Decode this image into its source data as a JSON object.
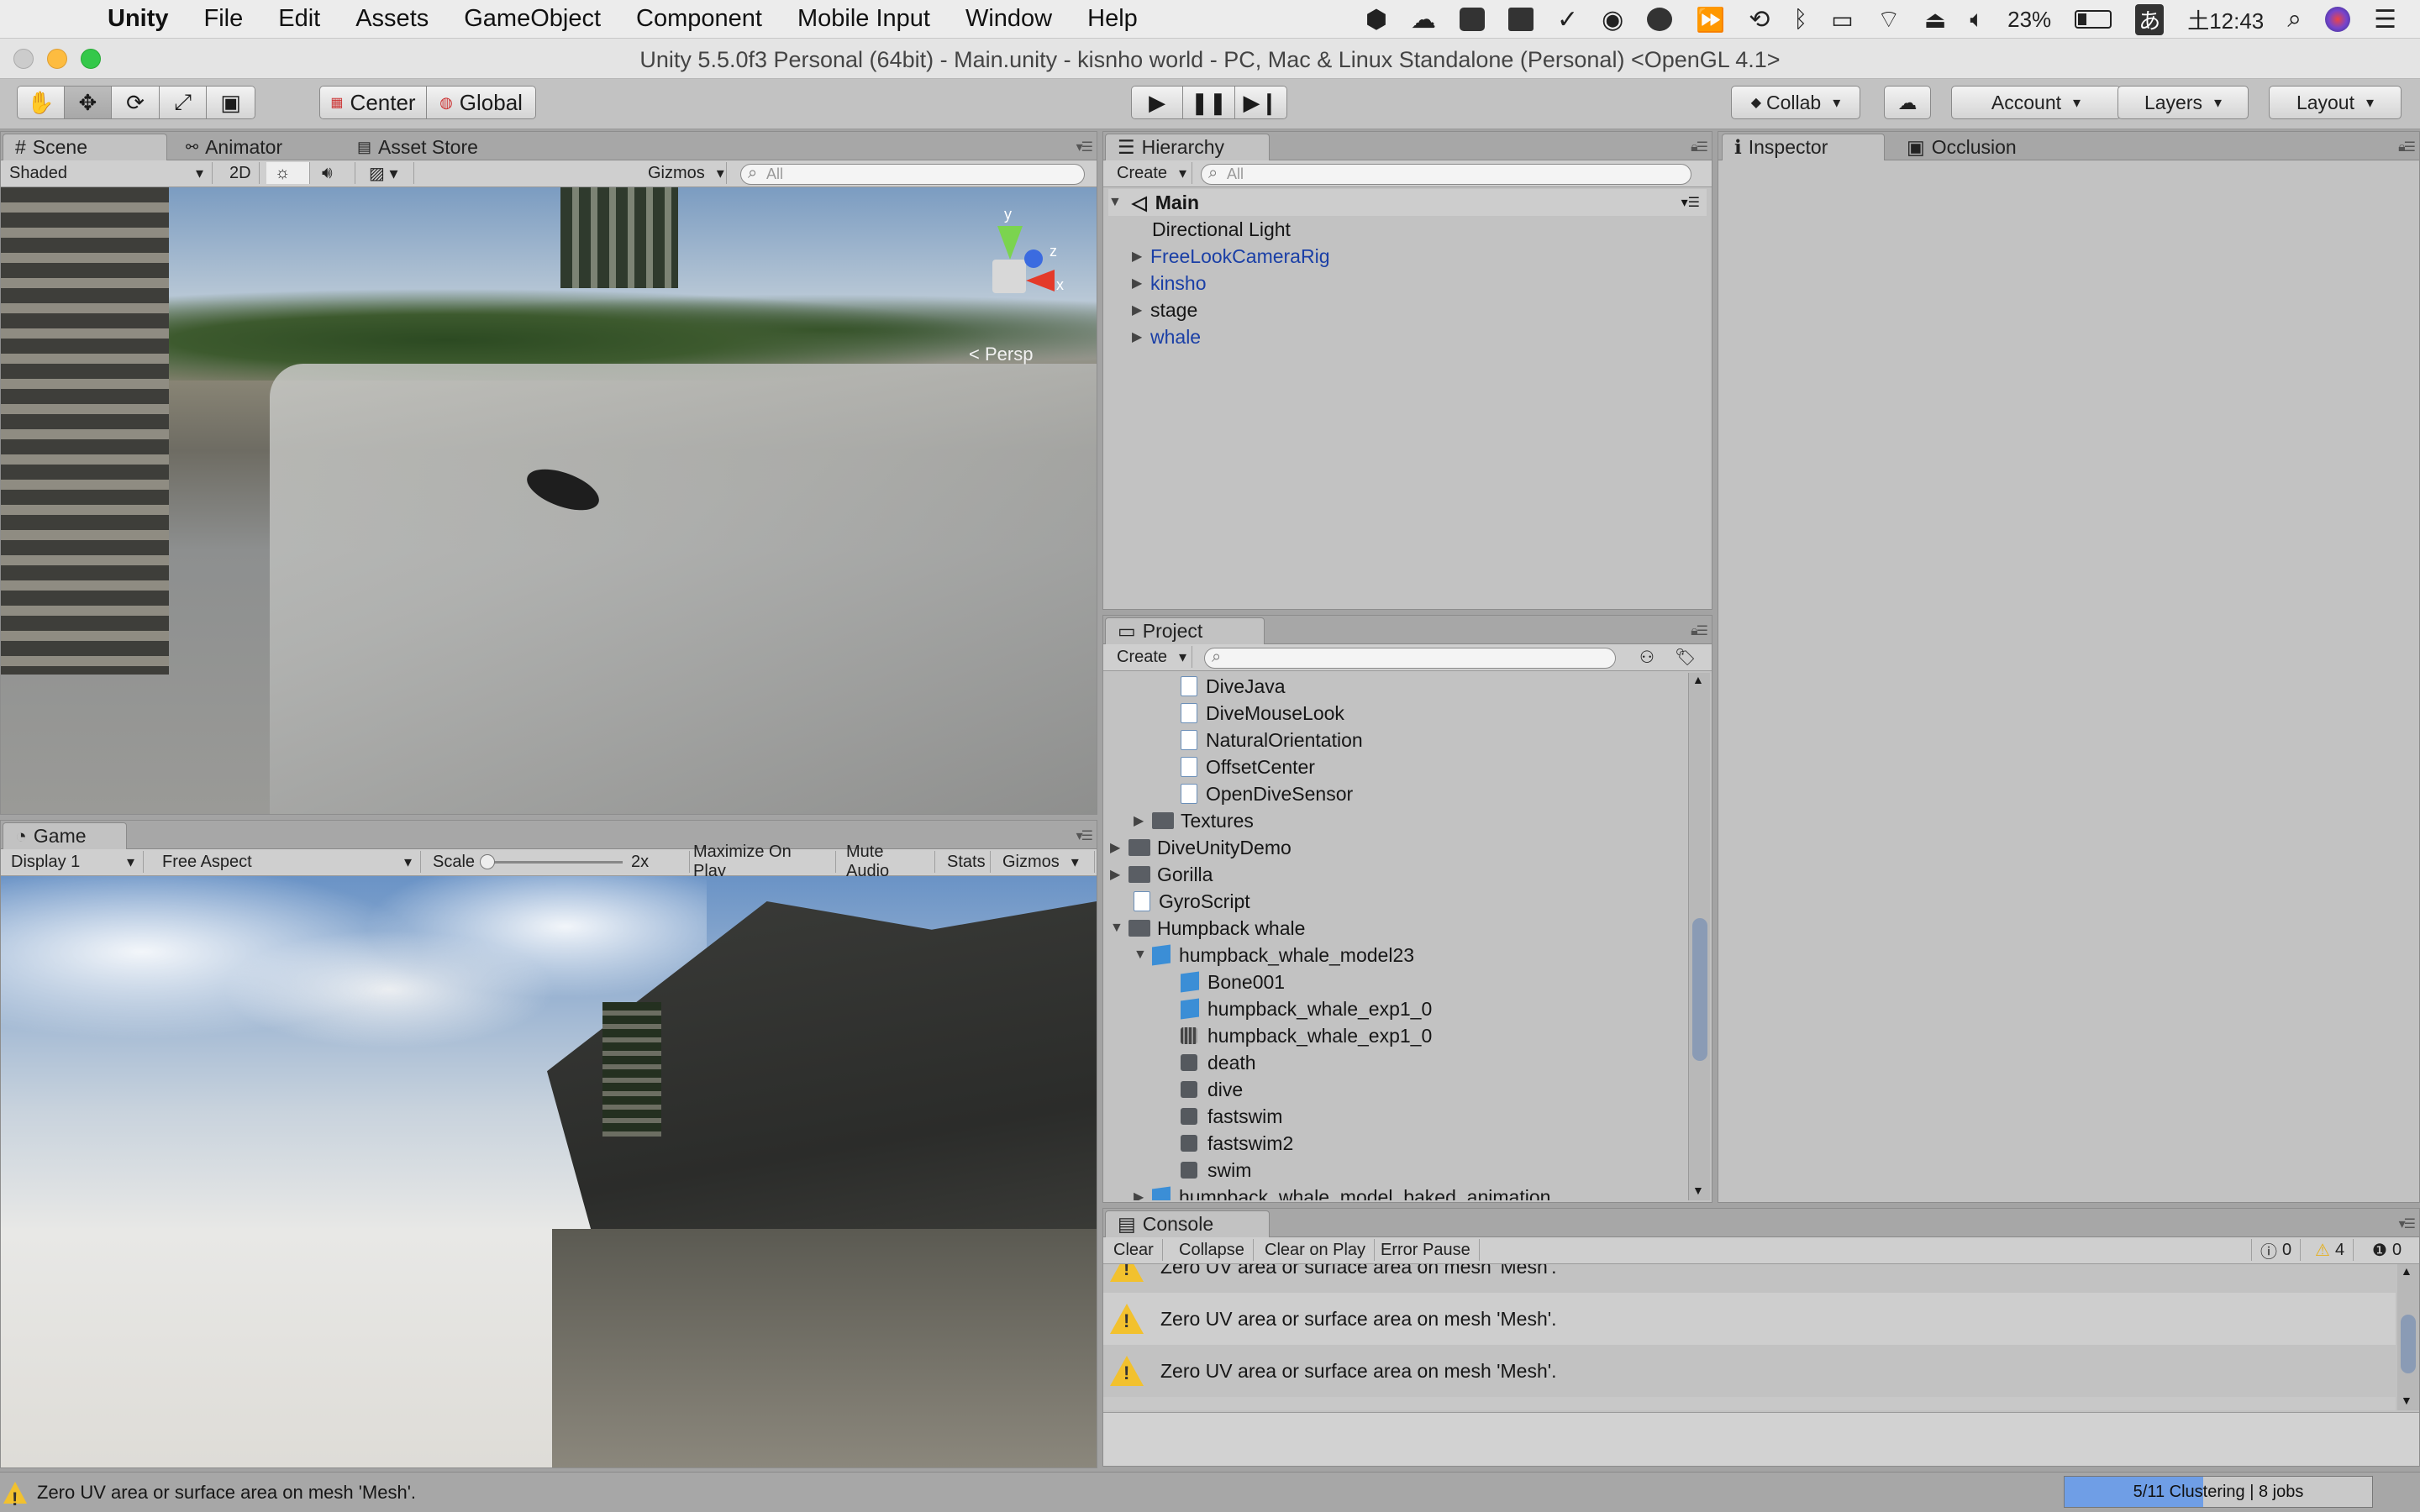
{
  "menubar": {
    "app": "Unity",
    "items": [
      "File",
      "Edit",
      "Assets",
      "GameObject",
      "Component",
      "Mobile Input",
      "Window",
      "Help"
    ],
    "battery": "23%",
    "ime": "あ",
    "clock": "土12:43"
  },
  "window": {
    "title": "Unity 5.5.0f3 Personal (64bit) - Main.unity - kisnho world - PC, Mac & Linux Standalone (Personal) <OpenGL 4.1>"
  },
  "toolbar": {
    "center": "Center",
    "global": "Global",
    "collab": "Collab",
    "account": "Account",
    "layers": "Layers",
    "layout": "Layout"
  },
  "scene": {
    "tabs": [
      "Scene",
      "Animator",
      "Asset Store"
    ],
    "shading": "Shaded",
    "mode2d": "2D",
    "gizmos": "Gizmos",
    "search_placeholder": "All",
    "persp": "Persp",
    "axis_x": "x",
    "axis_y": "y",
    "axis_z": "z"
  },
  "game": {
    "tab": "Game",
    "display": "Display 1",
    "aspect": "Free Aspect",
    "scale_label": "Scale",
    "scale_value": "2x",
    "maximize": "Maximize On Play",
    "mute": "Mute Audio",
    "stats": "Stats",
    "gizmos": "Gizmos"
  },
  "hierarchy": {
    "tab": "Hierarchy",
    "create": "Create",
    "search_placeholder": "All",
    "scene": "Main",
    "items": [
      "Directional Light",
      "FreeLookCameraRig",
      "kinsho",
      "stage",
      "whale"
    ]
  },
  "inspector": {
    "tabs": [
      "Inspector",
      "Occlusion"
    ]
  },
  "project": {
    "tab": "Project",
    "create": "Create",
    "items": [
      "DiveJava",
      "DiveMouseLook",
      "NaturalOrientation",
      "OffsetCenter",
      "OpenDiveSensor",
      "Textures",
      "DiveUnityDemo",
      "Gorilla",
      "GyroScript",
      "Humpback whale",
      "humpback_whale_model23",
      "Bone001",
      "humpback_whale_exp1_0",
      "humpback_whale_exp1_0",
      "death",
      "dive",
      "fastswim",
      "fastswim2",
      "swim",
      "humpback_whale_model_baked_animation"
    ]
  },
  "console": {
    "tab": "Console",
    "buttons": [
      "Clear",
      "Collapse",
      "Clear on Play",
      "Error Pause"
    ],
    "info_count": "0",
    "warn_count": "4",
    "error_count": "0",
    "messages": [
      "Zero UV area or surface area on mesh 'Mesh'.",
      "Zero UV area or surface area on mesh 'Mesh'.",
      "Zero UV area or surface area on mesh 'Mesh'."
    ]
  },
  "statusbar": {
    "message": "Zero UV area or surface area on mesh 'Mesh'.",
    "progress_text": "5/11 Clustering | 8 jobs",
    "progress_fraction": 0.45
  }
}
